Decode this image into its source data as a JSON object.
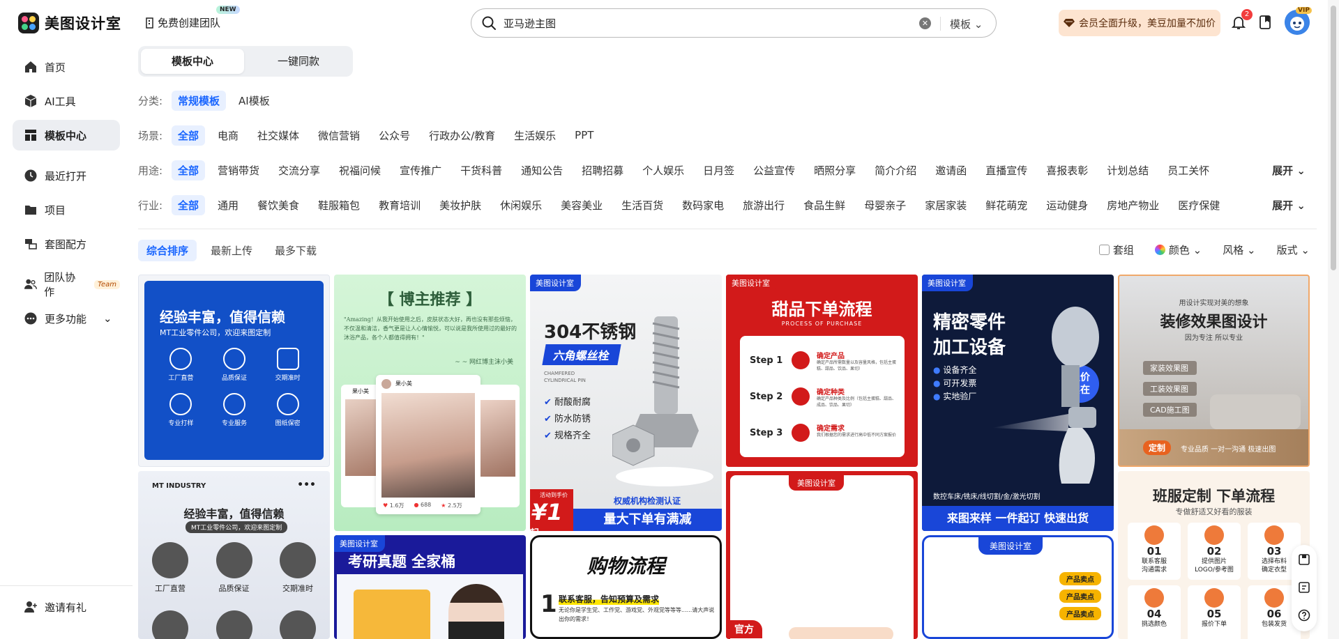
{
  "header": {
    "brand": "美图设计室",
    "team_create": "免费创建团队",
    "new_badge": "NEW",
    "search_value": "亚马逊主图",
    "search_type": "模板",
    "vip_banner": "会员全面升级，美豆加量不加价",
    "notif_count": "2",
    "vip_tag": "VIP"
  },
  "sidebar": {
    "items": [
      {
        "label": "首页",
        "icon": "home-icon"
      },
      {
        "label": "AI工具",
        "icon": "ai-cube-icon"
      },
      {
        "label": "模板中心",
        "icon": "template-grid-icon"
      },
      {
        "label": "最近打开",
        "icon": "clock-icon"
      },
      {
        "label": "项目",
        "icon": "folder-icon"
      },
      {
        "label": "套图配方",
        "icon": "recipe-icon"
      },
      {
        "label": "团队协作",
        "icon": "team-icon",
        "pill": "Team"
      },
      {
        "label": "更多功能",
        "icon": "more-icon"
      }
    ],
    "invite": "邀请有礼"
  },
  "tabs": [
    "模板中心",
    "一键同款"
  ],
  "filters": {
    "category": {
      "label": "分类:",
      "options": [
        "常规模板",
        "AI模板"
      ]
    },
    "scene": {
      "label": "场景:",
      "options": [
        "全部",
        "电商",
        "社交媒体",
        "微信营销",
        "公众号",
        "行政办公/教育",
        "生活娱乐",
        "PPT"
      ]
    },
    "usage": {
      "label": "用途:",
      "options": [
        "全部",
        "营销带货",
        "交流分享",
        "祝福问候",
        "宣传推广",
        "干货科普",
        "通知公告",
        "招聘招募",
        "个人娱乐",
        "日月签",
        "公益宣传",
        "晒照分享",
        "简介介绍",
        "邀请函",
        "直播宣传",
        "喜报表彰",
        "计划总结",
        "员工关怀"
      ]
    },
    "industry": {
      "label": "行业:",
      "options": [
        "全部",
        "通用",
        "餐饮美食",
        "鞋服箱包",
        "教育培训",
        "美妆护肤",
        "休闲娱乐",
        "美容美业",
        "生活百货",
        "数码家电",
        "旅游出行",
        "食品生鲜",
        "母婴亲子",
        "家居家装",
        "鲜花萌宠",
        "运动健身",
        "房地产物业",
        "医疗保健"
      ]
    },
    "expand_label": "展开"
  },
  "sort": {
    "options": [
      "综合排序",
      "最新上传",
      "最多下载"
    ],
    "tools": [
      "套组",
      "颜色",
      "风格",
      "版式"
    ]
  },
  "cards": {
    "brand_tag": "美图设计室",
    "c1": {
      "title": "经验丰富，值得信赖",
      "subtitle": "MT工业零件公司，欢迎来图定制",
      "icons": [
        "工厂直营",
        "品质保证",
        "交期准时",
        "专业打样",
        "专业服务",
        "图纸保密"
      ]
    },
    "c2": {
      "title": "【 博主推荐 】",
      "quote": "\"Amazing！从我开始使用之后，皮肤状态大好，再也没有那些烦恼，不仅温和清洁，香气更是让人心情愉悦，可以说是我所使用过的最好的沐浴产品，各个人都值得拥有！\"",
      "sign": "~ ~ 网红博主沫小美",
      "user": "果小美",
      "user2": "果小美",
      "stats": [
        "1.6万",
        "688",
        "2.5万"
      ]
    },
    "c3": {
      "title1": "304不锈钢",
      "title2": "六角螺丝栓",
      "sub1": "CHAMFERED",
      "sub2": "CYLINDRICAL PIN",
      "checks": [
        "耐酸耐腐",
        "防水防锈",
        "规格齐全"
      ],
      "promo_label": "活动到手价",
      "promo_price": "¥1",
      "promo_unit": "起",
      "auth": "权威机构检测认证",
      "bottom": "量大下单有满减"
    },
    "c4": {
      "title": "甜品下单流程",
      "subtitle": "PROCESS OF PURCHASE",
      "steps": [
        {
          "num": "Step 1",
          "name": "确定产品",
          "desc": "确定产品所需数量以及容量风格，包括主蛋糕、甜品、饮品、果切）"
        },
        {
          "num": "Step 2",
          "name": "确定种类",
          "desc": "确定产品种类及比例（包括主蛋糕、甜品、成品、饮品、果切）"
        },
        {
          "num": "Step 3",
          "name": "确定需求",
          "desc": "我们根据您的需求进行高中低不同方案报价"
        }
      ]
    },
    "c5": {
      "title1": "精密零件",
      "title2": "加工设备",
      "bullets": [
        "设备齐全",
        "可开发票",
        "实地验厂"
      ],
      "badge1": "报价",
      "badge2": "实在",
      "services": "数控车床/铣床/线切割/金/激光切割",
      "bottom": "来图来样 一件起订 快速出货"
    },
    "c6": {
      "top": "用设计实现对美的想象",
      "title": "装修效果图设计",
      "sub": "因为专注 所以专业",
      "tags": [
        "家装效果图",
        "工装效果图",
        "CAD施工图"
      ],
      "badge": "定制",
      "foot": "专业品质 一对一沟通 极速出图"
    },
    "c7": {
      "brand": "MT INDUSTRY",
      "title": "经验丰富，值得信赖",
      "subtitle": "MT工业零件公司，欢迎来图定制",
      "icons": [
        "工厂直营",
        "品质保证",
        "交期准时"
      ]
    },
    "c8": {
      "title": "考研真题 全家桶"
    },
    "c9": {
      "title": "购物流程",
      "step_num": "1",
      "step_title": "联系客服，告知预算及需求",
      "step_desc": "无论你是学生党、工作党、游戏党、外观党等等等......请大声说出你的需求！"
    },
    "c10": {
      "official": "官方"
    },
    "c11": {
      "labels": [
        "产品卖点",
        "产品卖点",
        "产品卖点"
      ]
    },
    "c12": {
      "title": "班服定制 下单流程",
      "sub": "专做舒适又好看的服装",
      "steps": [
        {
          "n": "01",
          "t": "联系客服\n沟通需求"
        },
        {
          "n": "02",
          "t": "提供图片\nLOGO/参考图"
        },
        {
          "n": "03",
          "t": "选择布料\n确定衣型"
        },
        {
          "n": "04",
          "t": "挑选颜色"
        },
        {
          "n": "05",
          "t": "报价下单"
        },
        {
          "n": "06",
          "t": "包装发货"
        }
      ]
    }
  },
  "colors": {
    "accent": "#1a66ff",
    "brand_blue": "#1946d8",
    "brand_red": "#d21a1a"
  }
}
